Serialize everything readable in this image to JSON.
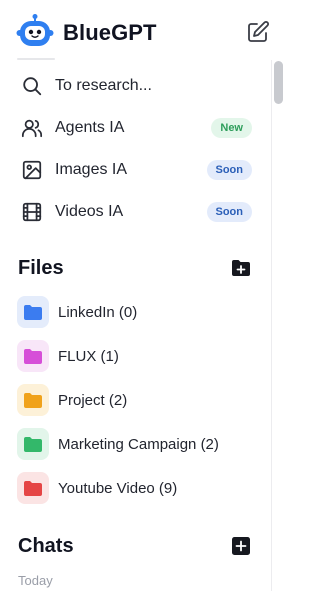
{
  "app": {
    "brand": "BlueGPT"
  },
  "nav": [
    {
      "label": "To research...",
      "icon": "search-icon",
      "badge": ""
    },
    {
      "label": "Agents IA",
      "icon": "users-icon",
      "badge": "New"
    },
    {
      "label": "Images IA",
      "icon": "image-icon",
      "badge": "Soon"
    },
    {
      "label": "Videos IA",
      "icon": "film-icon",
      "badge": "Soon"
    }
  ],
  "files": {
    "title": "Files",
    "folders": [
      {
        "label": "LinkedIn (0)",
        "color": "#3b7cf0",
        "bg": "#e4ecfb"
      },
      {
        "label": "FLUX (1)",
        "color": "#d64fd8",
        "bg": "#f8e6f8"
      },
      {
        "label": "Project (2)",
        "color": "#f0a21b",
        "bg": "#fdf1d8"
      },
      {
        "label": "Marketing Campaign (2)",
        "color": "#33b86a",
        "bg": "#e2f5ea"
      },
      {
        "label": "Youtube Video (9)",
        "color": "#e54545",
        "bg": "#fbe4e4"
      }
    ]
  },
  "chats": {
    "title": "Chats",
    "group": "Today"
  },
  "colors": {
    "accent": "#2b5fb8",
    "logo": "#2f7ff0"
  }
}
